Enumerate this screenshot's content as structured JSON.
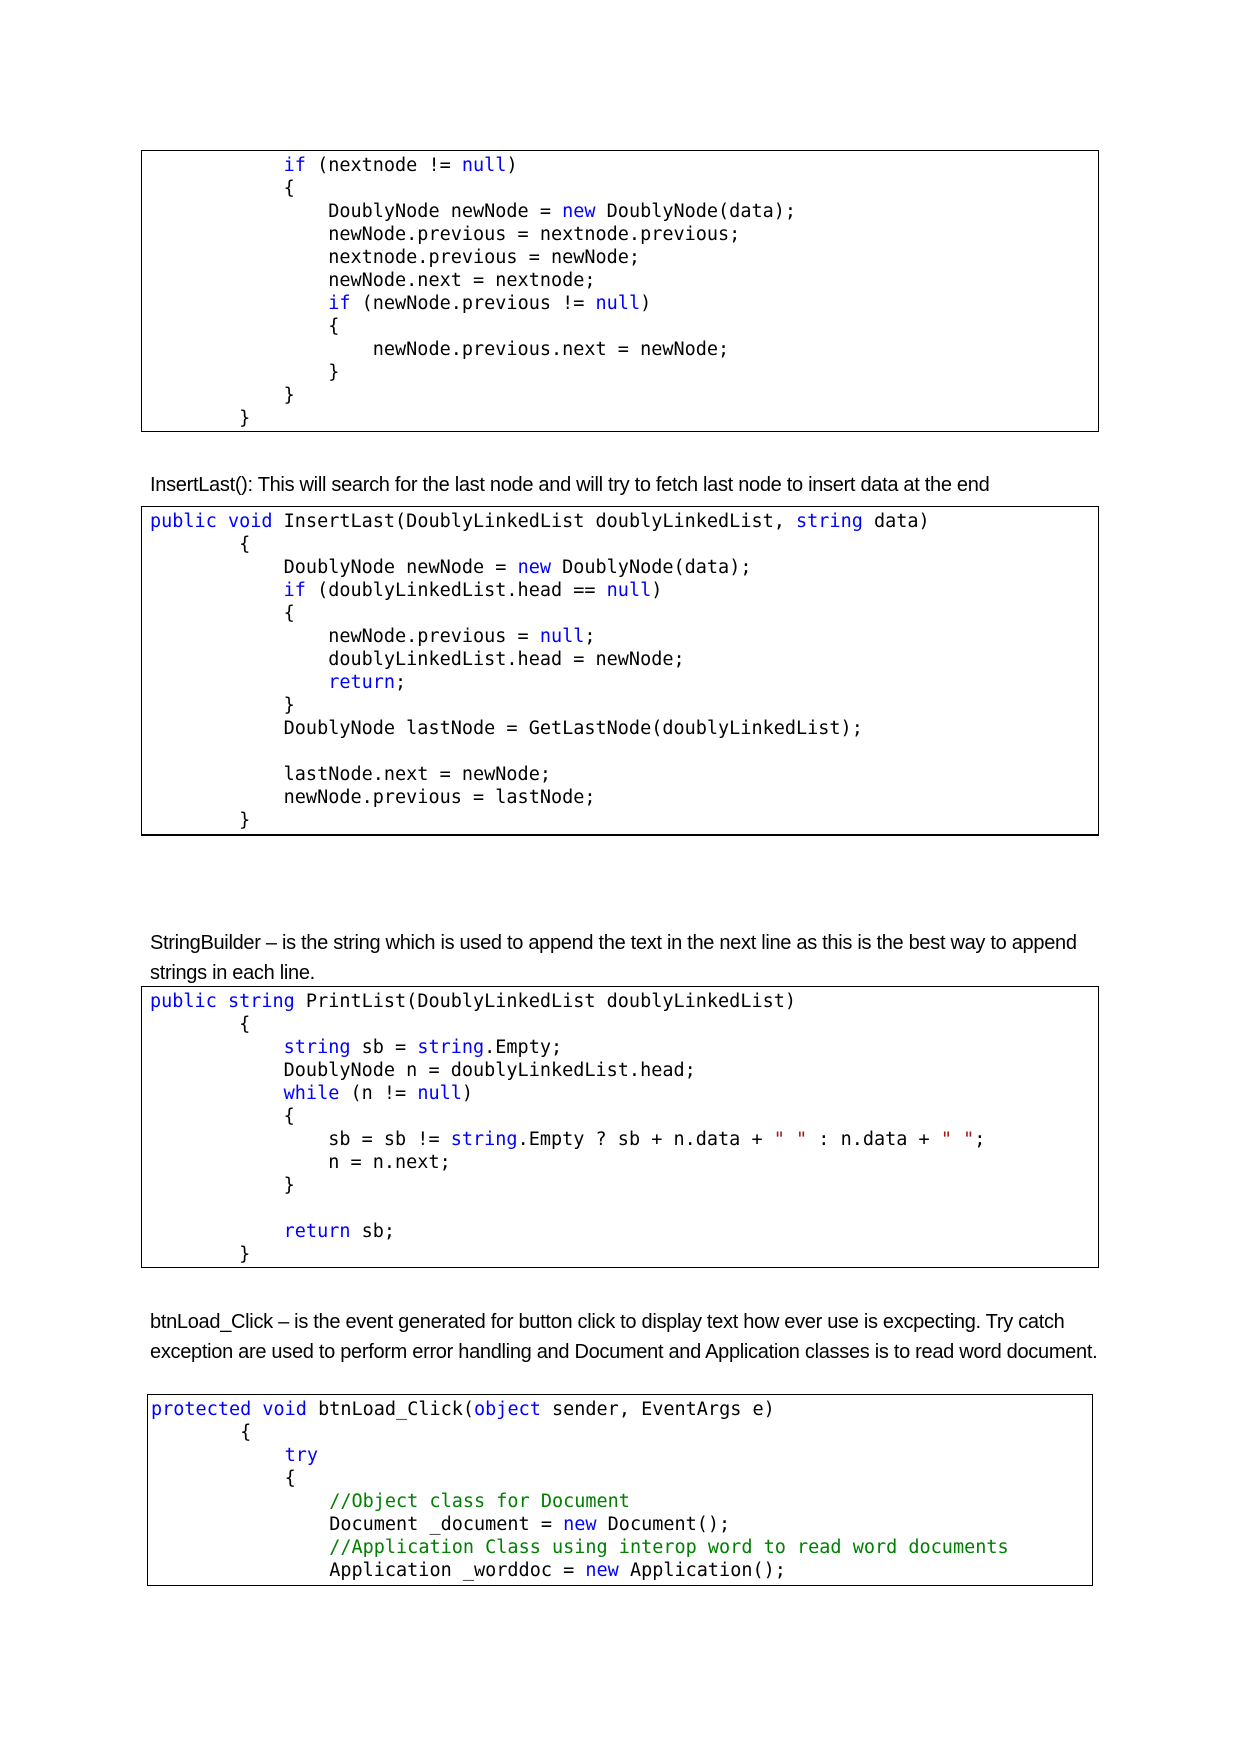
{
  "paragraphs": {
    "insert_last": "InsertLast(): This will search for the last node and will try to fetch last node to insert data at the end",
    "string_builder": "StringBuilder – is the string which is used to append the text in the next line as this is the best way to append strings in each line.",
    "btn_load_click": "btnLoad_Click – is the event generated for button click to display text how ever use is excpecting. Try catch exception are used to perform error handling and Document and Application classes is to read word document."
  },
  "code_blocks": [
    {
      "name": "insert-before-fragment",
      "lines": [
        [
          [
            "",
            "            "
          ],
          [
            "kw",
            "if"
          ],
          [
            "",
            " (nextnode != "
          ],
          [
            "kw",
            "null"
          ],
          [
            "",
            ")"
          ]
        ],
        [
          [
            "",
            "            {"
          ]
        ],
        [
          [
            "",
            "                DoublyNode newNode = "
          ],
          [
            "kw",
            "new"
          ],
          [
            "",
            " DoublyNode(data);"
          ]
        ],
        [
          [
            "",
            "                newNode.previous = nextnode.previous;"
          ]
        ],
        [
          [
            "",
            "                nextnode.previous = newNode;"
          ]
        ],
        [
          [
            "",
            "                newNode.next = nextnode;"
          ]
        ],
        [
          [
            "",
            "                "
          ],
          [
            "kw",
            "if"
          ],
          [
            "",
            " (newNode.previous != "
          ],
          [
            "kw",
            "null"
          ],
          [
            "",
            ")"
          ]
        ],
        [
          [
            "",
            "                {"
          ]
        ],
        [
          [
            "",
            "                    newNode.previous.next = newNode;"
          ]
        ],
        [
          [
            "",
            "                }"
          ]
        ],
        [
          [
            "",
            "            }"
          ]
        ],
        [
          [
            "",
            "        }"
          ]
        ]
      ]
    },
    {
      "name": "insert-last",
      "lines": [
        [
          [
            "kw",
            "public"
          ],
          [
            "",
            " "
          ],
          [
            "kw",
            "void"
          ],
          [
            "",
            " InsertLast(DoublyLinkedList doublyLinkedList, "
          ],
          [
            "kw",
            "string"
          ],
          [
            "",
            " data)"
          ]
        ],
        [
          [
            "",
            "        {"
          ]
        ],
        [
          [
            "",
            "            DoublyNode newNode = "
          ],
          [
            "kw",
            "new"
          ],
          [
            "",
            " DoublyNode(data);"
          ]
        ],
        [
          [
            "",
            "            "
          ],
          [
            "kw",
            "if"
          ],
          [
            "",
            " (doublyLinkedList.head == "
          ],
          [
            "kw",
            "null"
          ],
          [
            "",
            ")"
          ]
        ],
        [
          [
            "",
            "            {"
          ]
        ],
        [
          [
            "",
            "                newNode.previous = "
          ],
          [
            "kw",
            "null"
          ],
          [
            "",
            ";"
          ]
        ],
        [
          [
            "",
            "                doublyLinkedList.head = newNode;"
          ]
        ],
        [
          [
            "",
            "                "
          ],
          [
            "kw",
            "return"
          ],
          [
            "",
            ";"
          ]
        ],
        [
          [
            "",
            "            }"
          ]
        ],
        [
          [
            "",
            "            DoublyNode lastNode = GetLastNode(doublyLinkedList);"
          ]
        ],
        [
          [
            "",
            ""
          ]
        ],
        [
          [
            "",
            "            lastNode.next = newNode;"
          ]
        ],
        [
          [
            "",
            "            newNode.previous = lastNode;"
          ]
        ],
        [
          [
            "",
            "        }"
          ]
        ]
      ]
    },
    {
      "name": "print-list",
      "lines": [
        [
          [
            "kw",
            "public"
          ],
          [
            "",
            " "
          ],
          [
            "kw",
            "string"
          ],
          [
            "",
            " PrintList(DoublyLinkedList doublyLinkedList)"
          ]
        ],
        [
          [
            "",
            "        {"
          ]
        ],
        [
          [
            "",
            "            "
          ],
          [
            "kw",
            "string"
          ],
          [
            "",
            " sb = "
          ],
          [
            "kw",
            "string"
          ],
          [
            "",
            ".Empty;"
          ]
        ],
        [
          [
            "",
            "            DoublyNode n = doublyLinkedList.head;"
          ]
        ],
        [
          [
            "",
            "            "
          ],
          [
            "kw",
            "while"
          ],
          [
            "",
            " (n != "
          ],
          [
            "kw",
            "null"
          ],
          [
            "",
            ")"
          ]
        ],
        [
          [
            "",
            "            {"
          ]
        ],
        [
          [
            "",
            "                sb = sb != "
          ],
          [
            "kw",
            "string"
          ],
          [
            "",
            ".Empty ? sb + n.data + "
          ],
          [
            "str",
            "\" \""
          ],
          [
            "",
            " : n.data + "
          ],
          [
            "str",
            "\" \""
          ],
          [
            "",
            ";"
          ]
        ],
        [
          [
            "",
            "                n = n.next;"
          ]
        ],
        [
          [
            "",
            "            }"
          ]
        ],
        [
          [
            "",
            ""
          ]
        ],
        [
          [
            "",
            "            "
          ],
          [
            "kw",
            "return"
          ],
          [
            "",
            " sb;"
          ]
        ],
        [
          [
            "",
            "        }"
          ]
        ]
      ]
    },
    {
      "name": "btn-load-click",
      "lines": [
        [
          [
            "kw",
            "protected"
          ],
          [
            "",
            " "
          ],
          [
            "kw",
            "void"
          ],
          [
            "",
            " btnLoad_Click("
          ],
          [
            "kw",
            "object"
          ],
          [
            "",
            " sender, EventArgs e)"
          ]
        ],
        [
          [
            "",
            "        {"
          ]
        ],
        [
          [
            "",
            "            "
          ],
          [
            "kw",
            "try"
          ]
        ],
        [
          [
            "",
            "            {"
          ]
        ],
        [
          [
            "",
            "                "
          ],
          [
            "cm",
            "//Object class for Document"
          ]
        ],
        [
          [
            "",
            "                Document _document = "
          ],
          [
            "kw",
            "new"
          ],
          [
            "",
            " Document();"
          ]
        ],
        [
          [
            "",
            "                "
          ],
          [
            "cm",
            "//Application Class using interop word to read word documents"
          ]
        ],
        [
          [
            "",
            "                Application _worddoc = "
          ],
          [
            "kw",
            "new"
          ],
          [
            "",
            " Application();"
          ]
        ]
      ]
    }
  ],
  "colors": {
    "keyword": "#0000ff",
    "string": "#a31515",
    "comment": "#008000",
    "text": "#000000"
  }
}
